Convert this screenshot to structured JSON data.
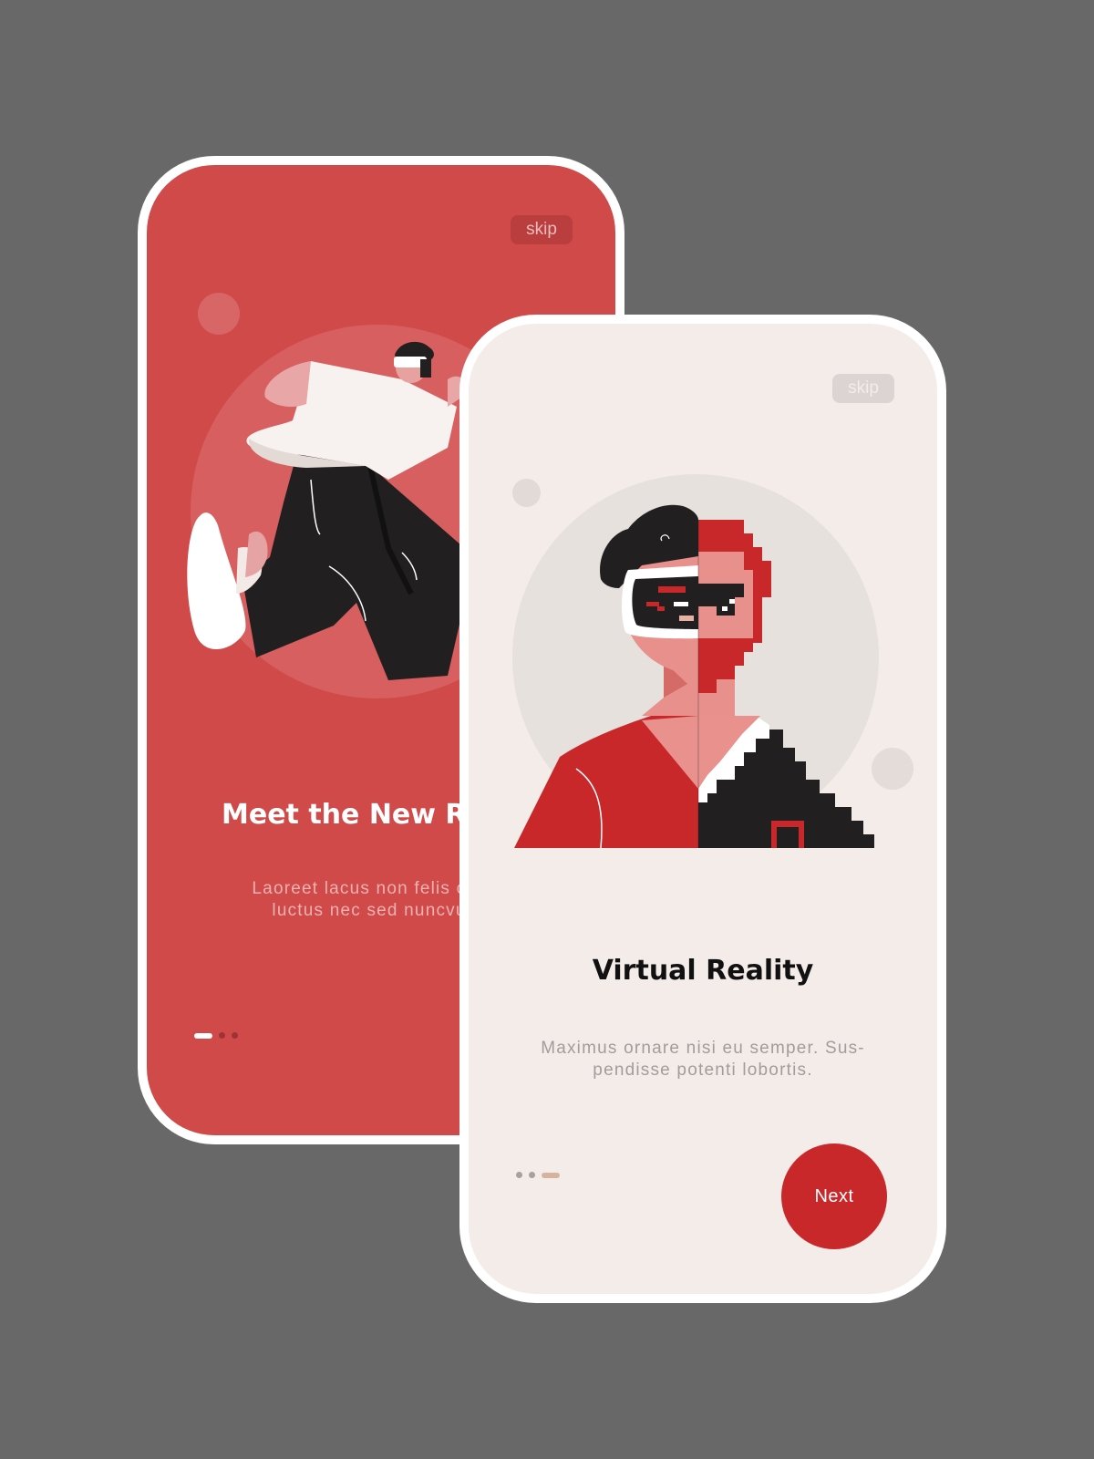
{
  "screens": [
    {
      "skip_label": "skip",
      "title": "Meet the New Reality",
      "description_line1": "Laoreet lacus non felis consequat,",
      "description_line2": "luctus nec sed nuncvulputate.",
      "page_indicator": {
        "current": 1,
        "total": 3
      }
    },
    {
      "skip_label": "skip",
      "title": "Virtual Reality",
      "description_line1": "Maximus ornare nisi eu semper. Sus-",
      "description_line2": "pendisse potenti lobortis.",
      "page_indicator": {
        "current": 3,
        "total": 3
      },
      "next_label": "Next"
    }
  ],
  "colors": {
    "background": "#686868",
    "screen1_background": "#d04a4a",
    "screen2_background": "#f3ece9",
    "accent_red": "#c9282b",
    "phone_frame": "#ffffff"
  },
  "illustrations": {
    "screen1": "jumping-man-vr-headset",
    "screen2": "half-pixel-vr-man-portrait"
  }
}
